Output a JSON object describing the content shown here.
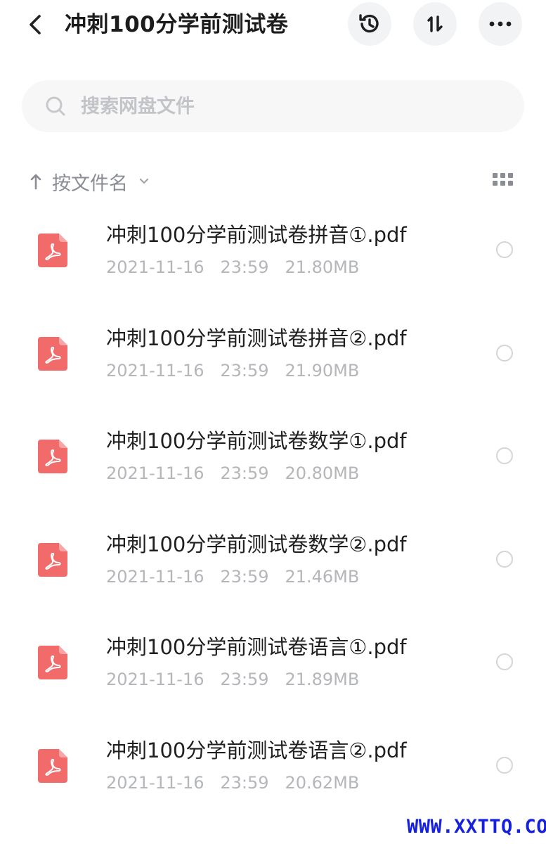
{
  "header": {
    "title": "冲刺100分学前测试卷",
    "icons": {
      "back": "chevron-left-icon",
      "history": "history-icon",
      "sort": "sort-icon",
      "more": "more-icon"
    }
  },
  "search": {
    "placeholder": "搜索网盘文件"
  },
  "sortbar": {
    "label": "按文件名"
  },
  "files": [
    {
      "name": "冲刺100分学前测试卷拼音①.pdf",
      "date": "2021-11-16",
      "time": "23:59",
      "size": "21.80MB"
    },
    {
      "name": "冲刺100分学前测试卷拼音②.pdf",
      "date": "2021-11-16",
      "time": "23:59",
      "size": "21.90MB"
    },
    {
      "name": "冲刺100分学前测试卷数学①.pdf",
      "date": "2021-11-16",
      "time": "23:59",
      "size": "20.80MB"
    },
    {
      "name": "冲刺100分学前测试卷数学②.pdf",
      "date": "2021-11-16",
      "time": "23:59",
      "size": "21.46MB"
    },
    {
      "name": "冲刺100分学前测试卷语言①.pdf",
      "date": "2021-11-16",
      "time": "23:59",
      "size": "21.89MB"
    },
    {
      "name": "冲刺100分学前测试卷语言②.pdf",
      "date": "2021-11-16",
      "time": "23:59",
      "size": "20.62MB"
    }
  ],
  "colors": {
    "pdf_red": "#f26b6b",
    "meta_gray": "#b4b6ba",
    "watermark_blue": "#1520e0"
  },
  "watermark": "WWW.XXTTQ.COM"
}
